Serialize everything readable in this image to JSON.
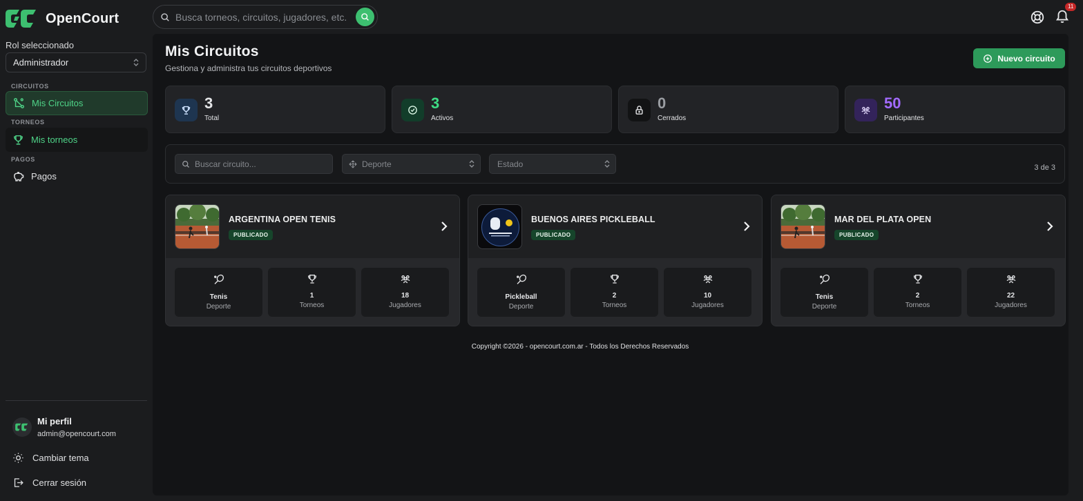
{
  "app": {
    "name": "OpenCourt"
  },
  "search": {
    "placeholder": "Busca torneos, circuitos, jugadores, etc."
  },
  "header": {
    "notifications_count": "11"
  },
  "sidebar": {
    "role_label": "Rol seleccionado",
    "role_value": "Administrador",
    "groups": [
      {
        "label": "CIRCUITOS",
        "items": [
          {
            "label": "Mis Circuitos",
            "icon": "route-icon"
          }
        ]
      },
      {
        "label": "TORNEOS",
        "items": [
          {
            "label": "Mis torneos",
            "icon": "trophy-icon"
          }
        ]
      },
      {
        "label": "PAGOS",
        "items": [
          {
            "label": "Pagos",
            "icon": "piggy-bank-icon"
          }
        ]
      }
    ],
    "profile": {
      "name": "Mi perfil",
      "email": "admin@opencourt.com"
    },
    "theme_label": "Cambiar tema",
    "logout_label": "Cerrar sesión"
  },
  "page": {
    "title": "Mis Circuitos",
    "subtitle": "Gestiona y administra tus circuitos deportivos",
    "new_button": "Nuevo circuito"
  },
  "stats": [
    {
      "value": "3",
      "label": "Total",
      "icon": "trophy-icon",
      "color": "#e4e5e7"
    },
    {
      "value": "3",
      "label": "Activos",
      "icon": "check-circle-icon",
      "color": "#3ddc84"
    },
    {
      "value": "0",
      "label": "Cerrados",
      "icon": "lock-icon",
      "color": "#9a9da2"
    },
    {
      "value": "50",
      "label": "Participantes",
      "icon": "users-icon",
      "color": "#a36bff"
    }
  ],
  "filters": {
    "search_placeholder": "Buscar circuito...",
    "sport_placeholder": "Deporte",
    "status_placeholder": "Estado",
    "count_text": "3 de 3"
  },
  "circuits": [
    {
      "name": "ARGENTINA OPEN TENIS",
      "status": "PUBLICADO",
      "sport": "Tenis",
      "sport_label": "Deporte",
      "tournaments": "1",
      "tournaments_label": "Torneos",
      "players": "18",
      "players_label": "Jugadores"
    },
    {
      "name": "BUENOS AIRES PICKLEBALL",
      "status": "PUBLICADO",
      "sport": "Pickleball",
      "sport_label": "Deporte",
      "tournaments": "2",
      "tournaments_label": "Torneos",
      "players": "10",
      "players_label": "Jugadores"
    },
    {
      "name": "MAR DEL PLATA OPEN",
      "status": "PUBLICADO",
      "sport": "Tenis",
      "sport_label": "Deporte",
      "tournaments": "2",
      "tournaments_label": "Torneos",
      "players": "22",
      "players_label": "Jugadores"
    }
  ],
  "footer": {
    "text": "Copyright ©2026 - opencourt.com.ar - Todos los Derechos Reservados"
  },
  "colors": {
    "accent": "#3dbf70",
    "background": "#1b1c1e",
    "panel": "#131416"
  }
}
